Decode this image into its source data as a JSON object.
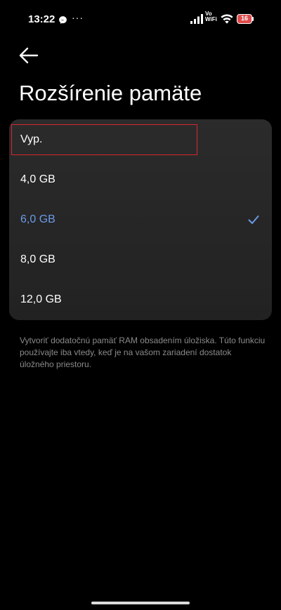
{
  "status_bar": {
    "time": "13:22",
    "more": "···",
    "vowifi_top": "Vo",
    "vowifi_bottom": "WiFi",
    "battery": "16",
    "icons": [
      "messenger-icon",
      "signal-icon",
      "wifi-icon",
      "battery-icon"
    ]
  },
  "header": {
    "back_icon": "arrow-left-icon",
    "title": "Rozšírenie pamäte"
  },
  "options": [
    {
      "label": "Vyp.",
      "selected": false,
      "highlighted": true
    },
    {
      "label": "4,0 GB",
      "selected": false
    },
    {
      "label": "6,0 GB",
      "selected": true
    },
    {
      "label": "8,0 GB",
      "selected": false
    },
    {
      "label": "12,0 GB",
      "selected": false
    }
  ],
  "selected_icon": "checkmark-icon",
  "description": "Vytvoriť dodatočnú pamäť RAM obsadením úložiska. Túto funkciu používajte iba vtedy, keď je na vašom zariadení dostatok úložného priestoru.",
  "colors": {
    "background": "#000000",
    "card": "#262626",
    "accent": "#6b9be8",
    "highlight_border": "#d6272c",
    "secondary_text": "#8a8a8a",
    "battery": "#e04b4b"
  }
}
